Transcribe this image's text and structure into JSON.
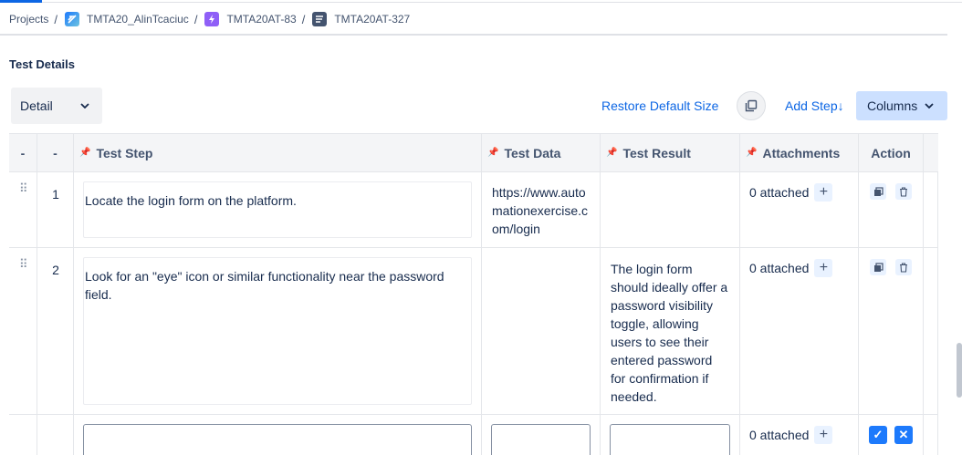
{
  "breadcrumb": {
    "items": [
      {
        "label": "Projects"
      },
      {
        "label": "TMTA20_AlinTcaciuc",
        "icon": "project-icon"
      },
      {
        "label": "TMTA20AT-83",
        "icon": "epic-icon"
      },
      {
        "label": "TMTA20AT-327",
        "icon": "test-icon"
      }
    ],
    "separator": "/"
  },
  "section_title": "Test Details",
  "toolbar": {
    "view_select": "Detail",
    "restore_label": "Restore Default Size",
    "add_step_label": "Add Step",
    "add_step_arrow": "↓",
    "columns_label": "Columns"
  },
  "table": {
    "headers": {
      "col1": "-",
      "col2": "-",
      "step": "Test Step",
      "data": "Test Data",
      "result": "Test Result",
      "attachments": "Attachments",
      "action": "Action"
    },
    "rows": [
      {
        "num": "1",
        "step": "Locate the login form on the platform.",
        "data": "https://www.automationexercise.com/login",
        "result": "",
        "attachments": "0 attached"
      },
      {
        "num": "2",
        "step": "Look for an \"eye\" icon or similar functionality near the password field.",
        "data": "",
        "result": "The login form should ideally offer a password visibility toggle, allowing users to see their entered password for confirmation if needed.",
        "attachments": "0 attached"
      }
    ],
    "new_row": {
      "attachments": "0 attached",
      "confirm_icon": "✓",
      "cancel_icon": "✕"
    }
  },
  "colors": {
    "accent": "#0c66e4",
    "columns_bg": "#cce0ff",
    "confirm_bg": "#1d7afc"
  }
}
